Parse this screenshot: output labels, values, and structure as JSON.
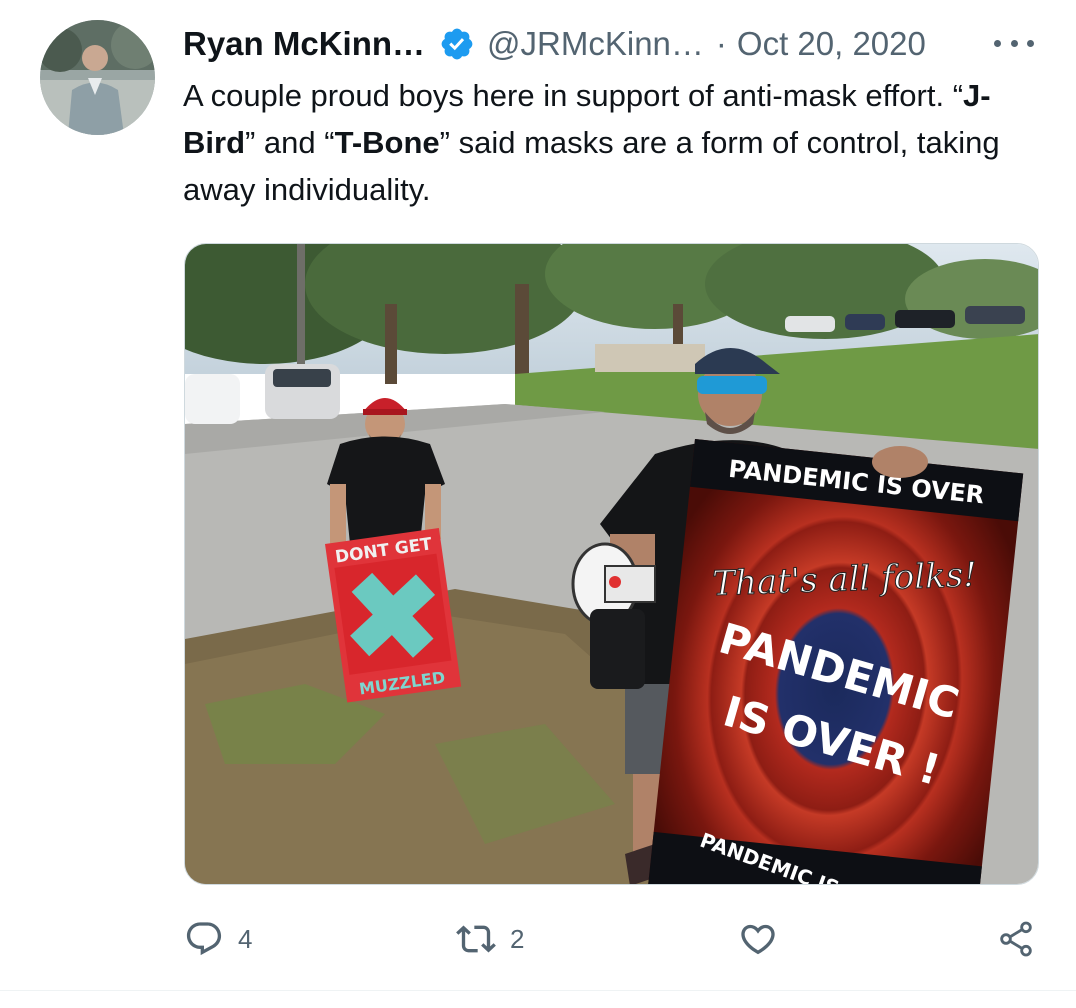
{
  "tweet": {
    "author": {
      "name": "Ryan McKinn…",
      "handle": "@JRMcKinn…",
      "verified": true,
      "avatar": "avatar-photo"
    },
    "separator": "·",
    "date": "Oct 20, 2020",
    "more_icon": "more-horizontal-icon",
    "text": {
      "part1": "A couple proud boys here in support of anti-mask effort. “",
      "bold1": "J-Bird",
      "part2": "” and “",
      "bold2": "T-Bone",
      "part3": "” said masks are a form of control, taking away individuality."
    },
    "media": {
      "type": "photo",
      "sign_left": {
        "top": "DONT GET",
        "bottom": "MUZZLED"
      },
      "sign_right": {
        "top_banner": "PANDEMIC IS OVER",
        "script": "That's all folks!",
        "line1": "PANDEMIC",
        "line2": "IS OVER !",
        "bottom_banner": "PANDEMIC IS OVER"
      }
    },
    "actions": {
      "reply": {
        "icon": "reply-icon",
        "count": "4"
      },
      "retweet": {
        "icon": "retweet-icon",
        "count": "2"
      },
      "like": {
        "icon": "heart-icon",
        "count": ""
      },
      "share": {
        "icon": "share-icon"
      }
    },
    "colors": {
      "verified": "#1d9bf0",
      "secondary_text": "#536471",
      "primary_text": "#0f1419"
    }
  }
}
